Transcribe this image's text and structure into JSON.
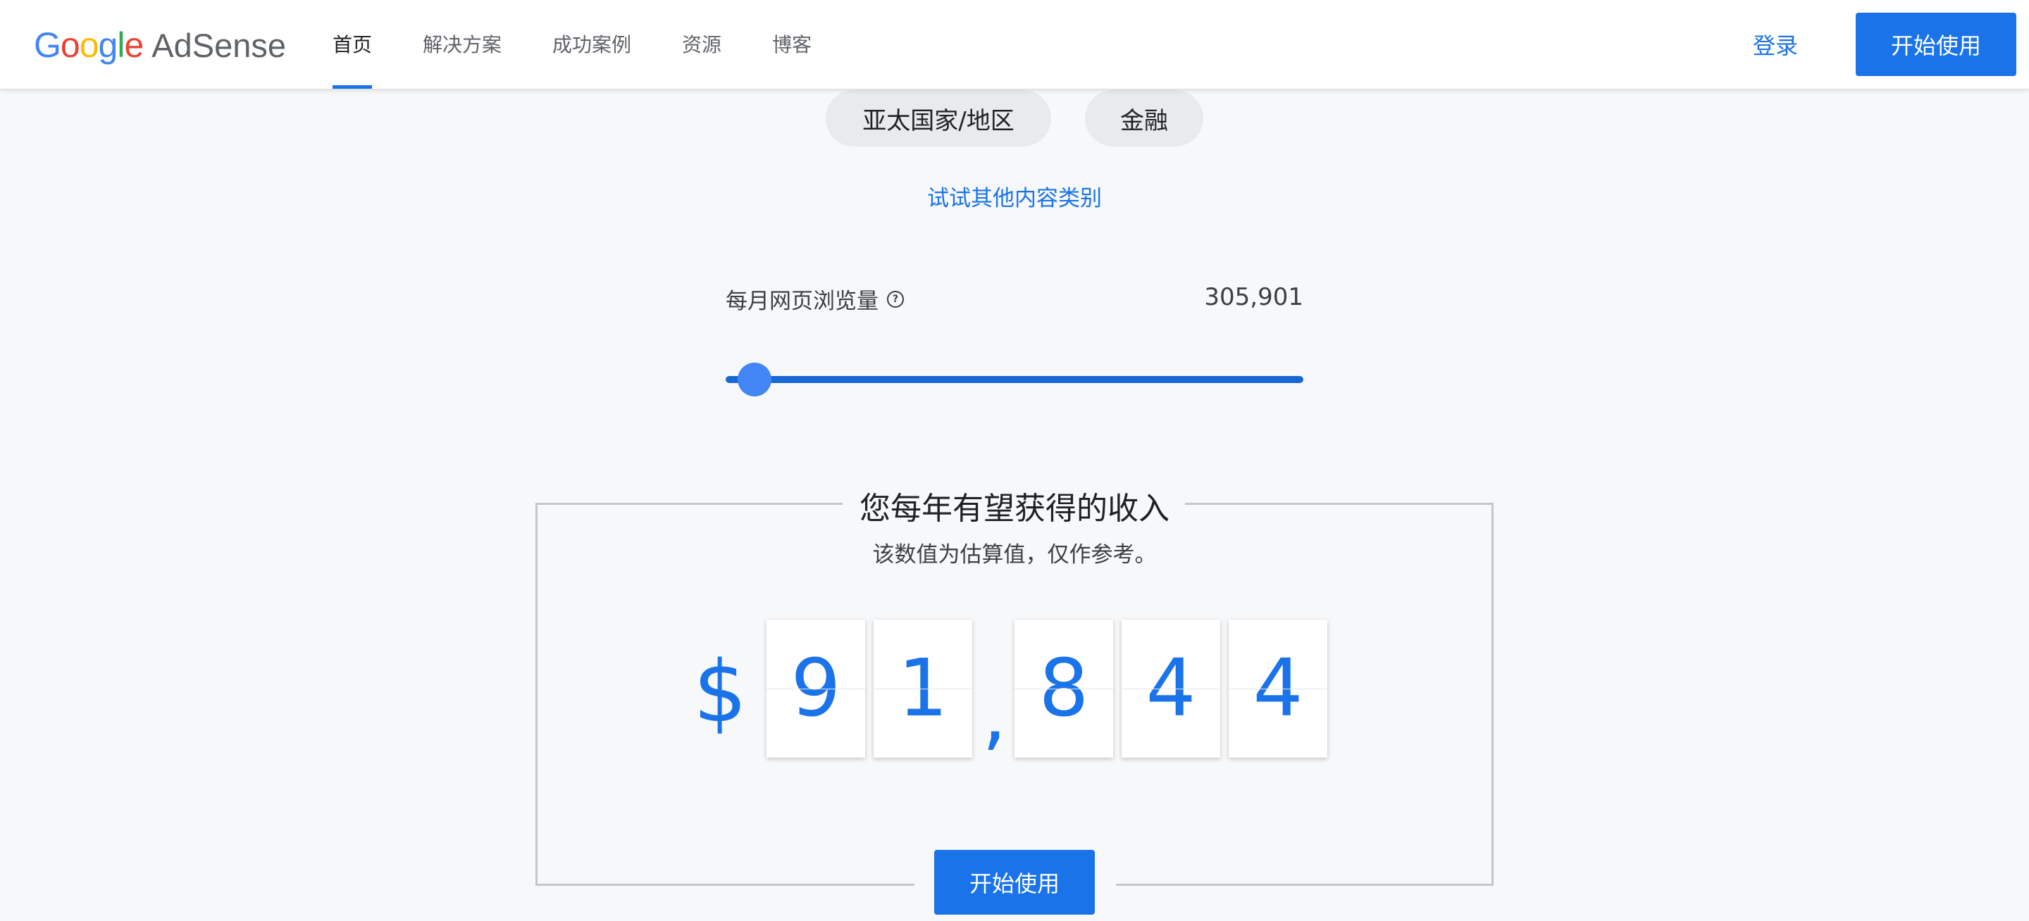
{
  "header": {
    "logo_google": "Google",
    "logo_product": "AdSense",
    "nav": [
      {
        "label": "首页",
        "active": true
      },
      {
        "label": "解决方案",
        "active": false
      },
      {
        "label": "成功案例",
        "active": false
      },
      {
        "label": "资源",
        "active": false
      },
      {
        "label": "博客",
        "active": false
      }
    ],
    "signin_label": "登录",
    "start_label": "开始使用"
  },
  "filters": {
    "region": "亚太国家/地区",
    "category": "金融",
    "other_link": "试试其他内容类别"
  },
  "pageviews": {
    "label": "每月网页浏览量",
    "help_icon": "help-circle-icon",
    "value": "305,901",
    "slider_fraction": 0.05
  },
  "earnings": {
    "title": "您每年有望获得的收入",
    "subtitle": "该数值为估算值，仅作参考。",
    "currency": "$",
    "digits": [
      "9",
      "1",
      "8",
      "4",
      "4"
    ],
    "separator": ",",
    "cta_label": "开始使用"
  },
  "colors": {
    "accent": "#1a73e8",
    "background": "#f6f8fa",
    "chip": "#e8eaed"
  }
}
